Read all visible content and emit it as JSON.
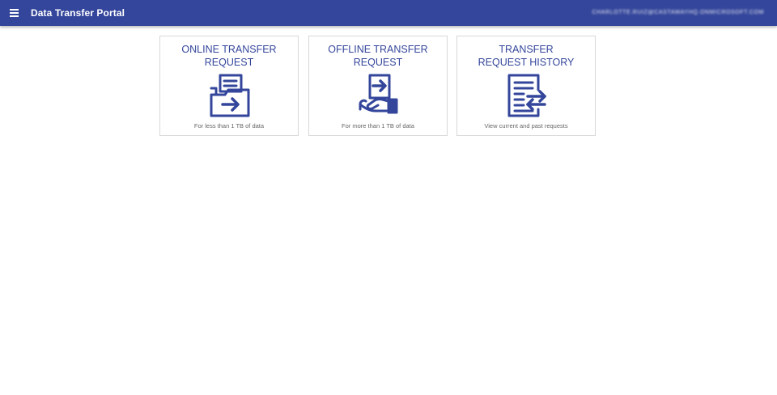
{
  "appbar": {
    "menu_icon": "hamburger-menu-icon",
    "title": "Data Transfer Portal",
    "user_email": "CHARLOTTE.RUIZ@CASTAWAYHQ.ONMICROSOFT.COM"
  },
  "cards": [
    {
      "title": "ONLINE TRANSFER REQUEST",
      "subtitle": "For less than 1 TB of data",
      "icon": "folder-transfer-icon"
    },
    {
      "title": "OFFLINE TRANSFER REQUEST",
      "subtitle": "For more than 1 TB of data",
      "icon": "hand-device-transfer-icon"
    },
    {
      "title": "TRANSFER REQUEST HISTORY",
      "subtitle": "View current and past requests",
      "icon": "document-history-icon"
    }
  ],
  "colors": {
    "brand": "#34469b",
    "card_border": "#d8d8d8",
    "subtitle_text": "#666666"
  }
}
